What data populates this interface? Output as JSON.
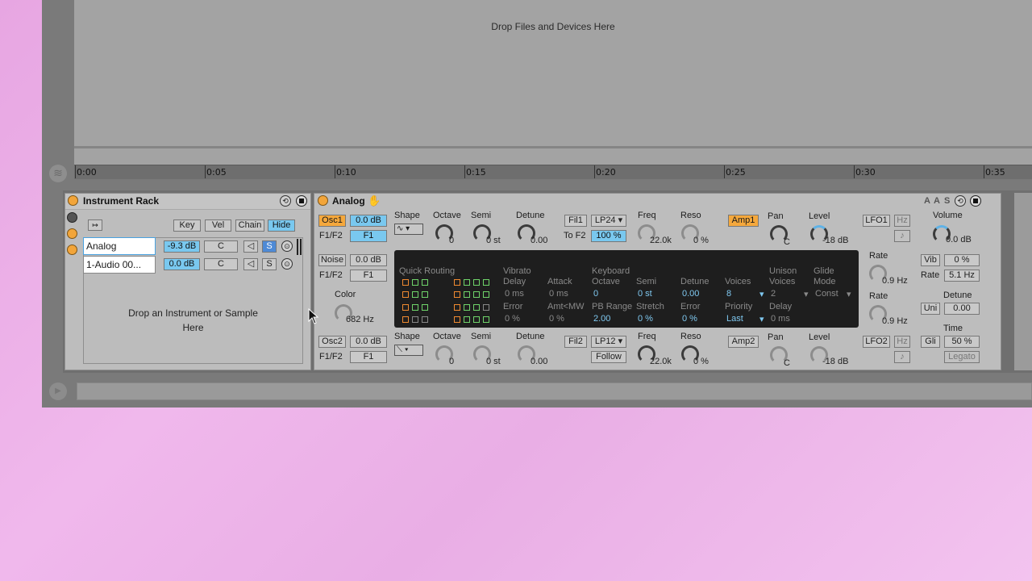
{
  "arrangement": {
    "drop_text": "Drop Files and Devices Here"
  },
  "ruler": {
    "ticks": [
      "0:00",
      "0:05",
      "0:10",
      "0:15",
      "0:20",
      "0:25",
      "0:30",
      "0:35"
    ]
  },
  "rack": {
    "title": "Instrument Rack",
    "buttons": {
      "key": "Key",
      "vel": "Vel",
      "chain": "Chain",
      "hide": "Hide"
    },
    "chains": [
      {
        "name": "Analog",
        "volume": "-9.3 dB",
        "pan": "C",
        "solo": "S"
      },
      {
        "name": "1-Audio 00...",
        "volume": "0.0 dB",
        "pan": "C",
        "solo": "S"
      }
    ],
    "drop_text_1": "Drop an Instrument or Sample",
    "drop_text_2": "Here"
  },
  "analog": {
    "title": "Analog",
    "header_buttons": [
      "A",
      "A",
      "S"
    ],
    "osc1": {
      "label": "Osc1",
      "level": "0.0 dB",
      "f1f2_label": "F1/F2",
      "f1f2": "F1"
    },
    "noise": {
      "label": "Noise",
      "level": "0.0 dB",
      "f1f2_label": "F1/F2",
      "f1f2": "F1",
      "color_label": "Color",
      "color_value": "682 Hz"
    },
    "osc2": {
      "label": "Osc2",
      "level": "0.0 dB",
      "f1f2_label": "F1/F2",
      "f1f2": "F1"
    },
    "shape1": {
      "label": "Shape",
      "value": "∿"
    },
    "shape2": {
      "label": "Shape",
      "value": "⟍"
    },
    "octave_label": "Octave",
    "semi_label": "Semi",
    "detune_label": "Detune",
    "osc1_params": {
      "octave": "0",
      "semi": "0 st",
      "detune": "0.00"
    },
    "osc2_params": {
      "octave": "0",
      "semi": "0 st",
      "detune": "0.00"
    },
    "fil1": {
      "label": "Fil1",
      "type": "LP24",
      "to_label": "To F2",
      "to_value": "100 %",
      "freq_label": "Freq",
      "freq": "22.0k",
      "reso_label": "Reso",
      "reso": "0 %"
    },
    "fil2": {
      "label": "Fil2",
      "type": "LP12",
      "follow": "Follow",
      "freq_label": "Freq",
      "freq": "22.0k",
      "reso_label": "Reso",
      "reso": "0 %"
    },
    "amp1": {
      "label": "Amp1",
      "pan_label": "Pan",
      "pan": "C",
      "level_label": "Level",
      "level": "-18 dB"
    },
    "amp2": {
      "label": "Amp2",
      "pan_label": "Pan",
      "pan": "C",
      "level_label": "Level",
      "level": "-18 dB"
    },
    "lfo1": {
      "label": "LFO1",
      "hz": "Hz",
      "rate_label": "Rate",
      "rate": "0.9 Hz"
    },
    "lfo2": {
      "label": "LFO2",
      "hz": "Hz",
      "rate_label": "Rate",
      "rate": "0.9 Hz"
    },
    "global": {
      "volume_label": "Volume",
      "volume": "0.0 dB",
      "vib_label": "Vib",
      "vib": "0 %",
      "rate_label": "Rate",
      "rate": "5.1 Hz",
      "detune_label": "Detune",
      "uni_label": "Uni",
      "uni": "0.00",
      "time_label": "Time",
      "gli_label": "Gli",
      "gli": "50 %",
      "legato": "Legato"
    },
    "matrix": {
      "quick_routing": "Quick Routing",
      "vibrato": "Vibrato",
      "delay_label": "Delay",
      "attack_label": "Attack",
      "delay": "0 ms",
      "attack": "0 ms",
      "error_label": "Error",
      "amt_label": "Amt<MW",
      "error": "0 %",
      "amt": "0 %",
      "keyboard": "Keyboard",
      "octave_label": "Octave",
      "semi_label": "Semi",
      "detune_label": "Detune",
      "voices_label": "Voices",
      "octave": "0",
      "semi": "0 st",
      "detune": "0.00",
      "voices": "8",
      "pb_label": "PB Range",
      "stretch_label": "Stretch",
      "kerror_label": "Error",
      "priority_label": "Priority",
      "pb": "2.00",
      "stretch": "0 %",
      "kerror": "0 %",
      "priority": "Last",
      "unison": "Unison",
      "uvoices_label": "Voices",
      "uvoices": "2",
      "udelay_label": "Delay",
      "udelay": "0 ms",
      "glide": "Glide",
      "mode_label": "Mode",
      "mode": "Const"
    }
  }
}
